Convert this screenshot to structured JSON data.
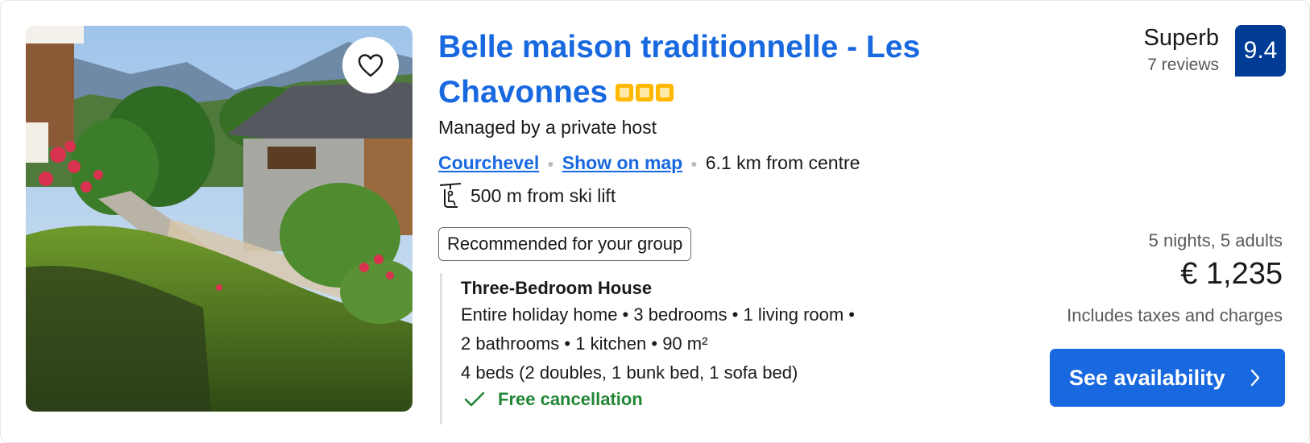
{
  "property": {
    "title": "Belle maison traditionnelle - Les Chavonnes",
    "star_rating": 3,
    "managed_by": "Managed by a private host",
    "location_link": "Courchevel",
    "map_link": "Show on map",
    "distance": "6.1 km from centre",
    "ski_lift": "500 m from ski lift",
    "badge": "Recommended for your group"
  },
  "unit": {
    "name": "Three-Bedroom House",
    "line1": "Entire holiday home • 3 bedrooms • 1 living room •",
    "line2": "2 bathrooms • 1 kitchen • 90 m²",
    "line3": "4 beds (2 doubles, 1 bunk bed, 1 sofa bed)",
    "cancellation": "Free cancellation"
  },
  "rating": {
    "word": "Superb",
    "reviews": "7 reviews",
    "score": "9.4"
  },
  "pricing": {
    "stay": "5 nights, 5 adults",
    "price": "€ 1,235",
    "taxes": "Includes taxes and charges",
    "cta": "See availability"
  },
  "icons": {
    "favorite": "heart-icon",
    "ski_lift": "ski-lift-icon",
    "check": "check-icon",
    "chevron": "chevron-right-icon"
  },
  "colors": {
    "link": "#1868e0",
    "score_badge": "#003b95",
    "stars": "#ffb700",
    "cancellation": "#238636"
  }
}
